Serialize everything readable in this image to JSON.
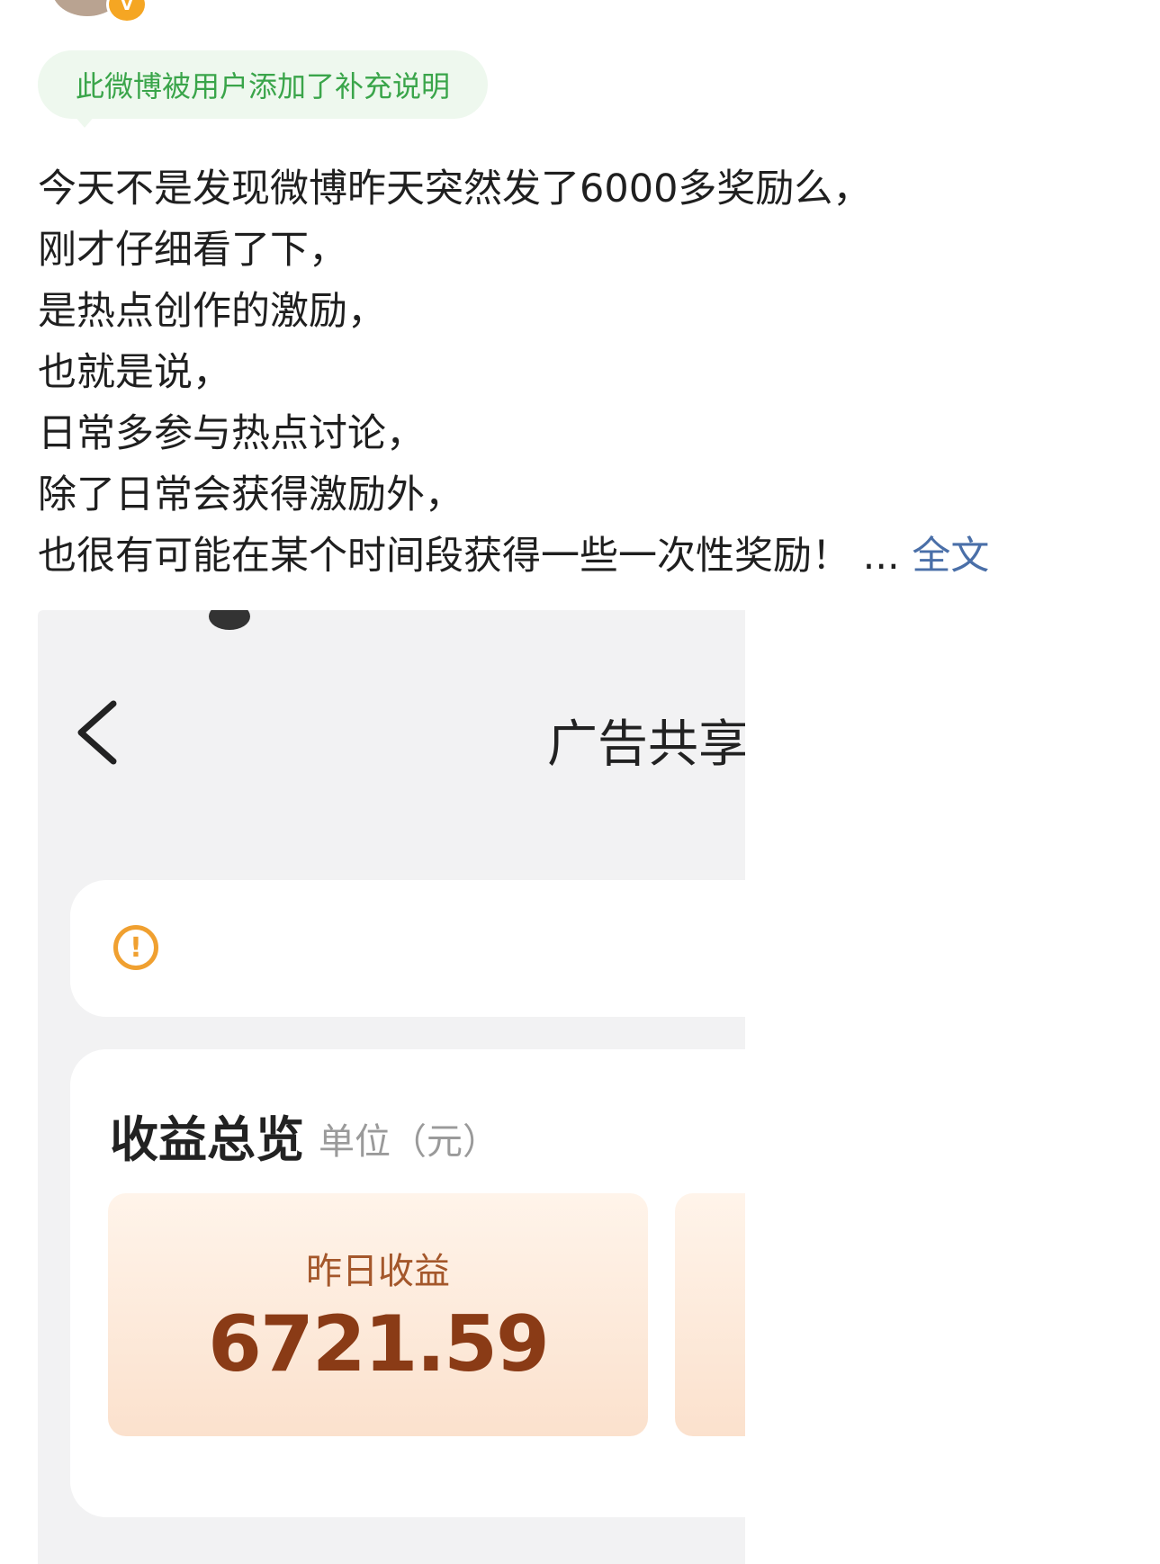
{
  "notice": {
    "text": "此微博被用户添加了补充说明"
  },
  "post": {
    "lines": [
      "今天不是发现微博昨天突然发了6000多奖励么，",
      "刚才仔细看了下，",
      "是热点创作的激励，",
      "也就是说，",
      "日常多参与热点讨论，",
      "除了日常会获得激励外，",
      "也很有可能在某个时间段获得一些一次性奖励！"
    ],
    "ellipsis": " ... ",
    "more_label": "全文"
  },
  "screenshot": {
    "page_title": "广告共享",
    "earnings": {
      "title": "收益总览",
      "unit": "单位（元）",
      "yesterday_label": "昨日收益",
      "yesterday_value": "6721.59"
    }
  },
  "colors": {
    "notice_green": "#3aa54a",
    "link_blue": "#4a6fa8",
    "earnings_brown": "#8a3b16",
    "alert_orange": "#f0a030"
  }
}
